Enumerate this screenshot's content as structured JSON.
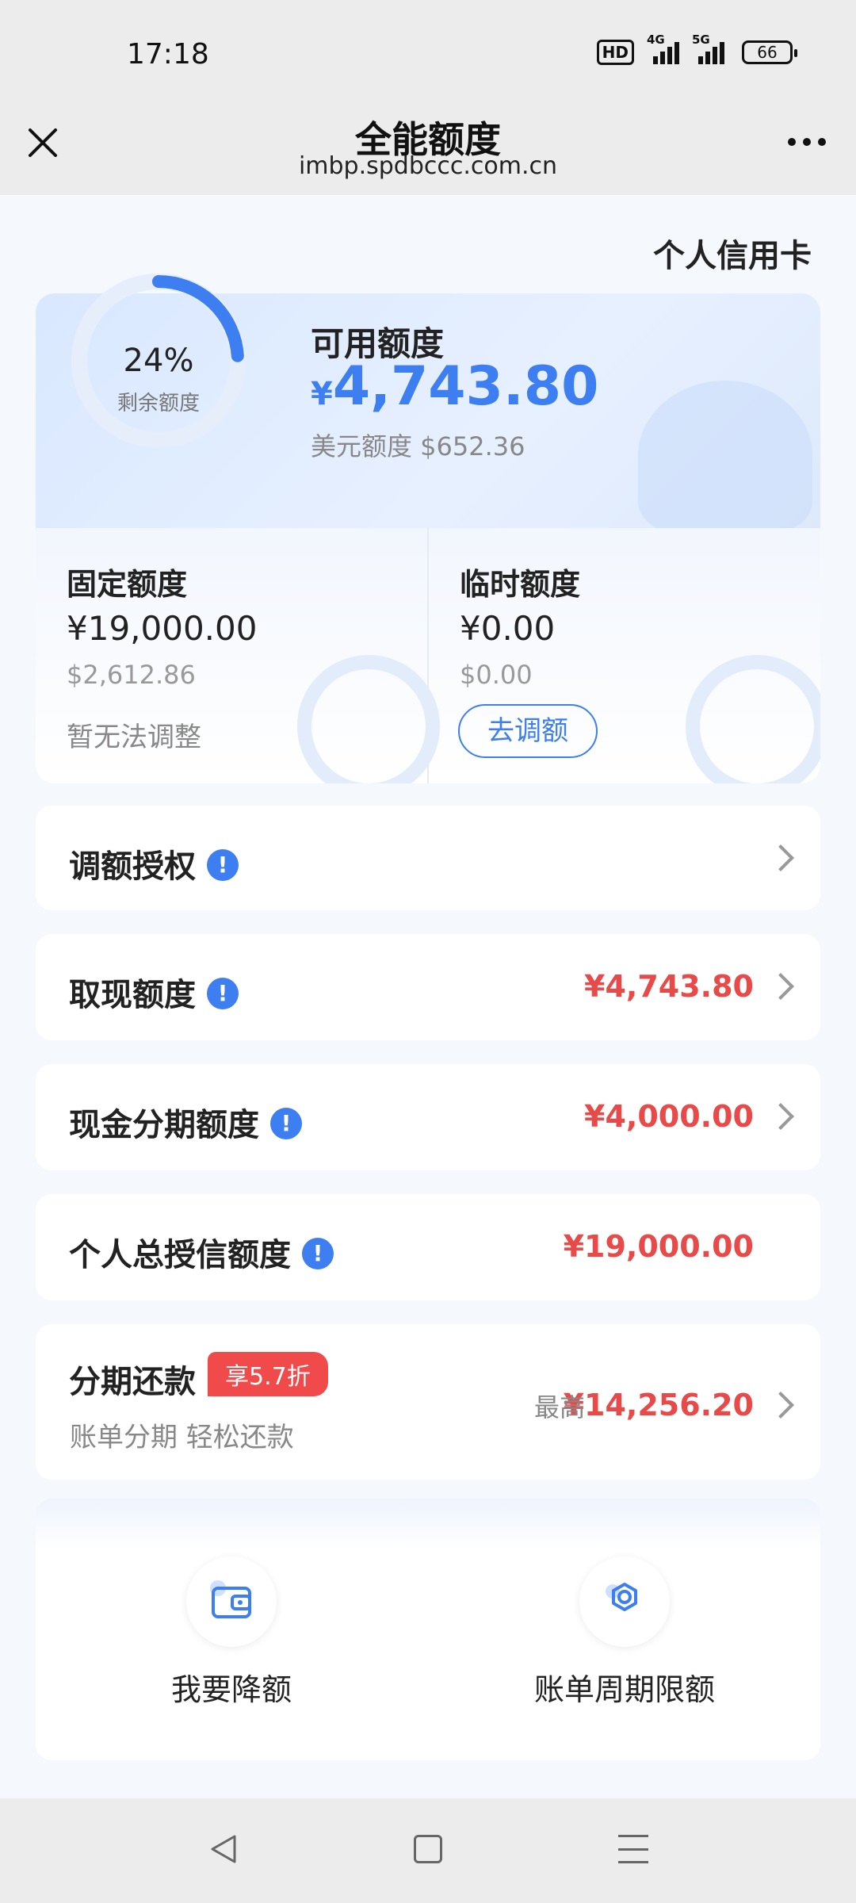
{
  "status_bar": {
    "time": "17:18",
    "hd": "HD",
    "net1": "4G",
    "net2": "5G",
    "battery": "66"
  },
  "header": {
    "title": "全能额度",
    "url": "imbp.spdbccc.com.cn"
  },
  "card_type": "个人信用卡",
  "summary": {
    "ring_percent": "24%",
    "ring_label": "剩余额度",
    "ring_fraction": 0.24,
    "available_label": "可用额度",
    "available_currency": "¥",
    "available_amount": "4,743.80",
    "usd_line": "美元额度 $652.36"
  },
  "fixed": {
    "label": "固定额度",
    "amount": "¥19,000.00",
    "usd": "$2,612.86",
    "note": "暂无法调整"
  },
  "temp": {
    "label": "临时额度",
    "amount": "¥0.00",
    "usd": "$0.00",
    "button": "去调额"
  },
  "rows": {
    "auth": {
      "label": "调额授权"
    },
    "cash": {
      "label": "取现额度",
      "value": "¥4,743.80"
    },
    "cash_installment": {
      "label": "现金分期额度",
      "value": "¥4,000.00"
    },
    "total_credit": {
      "label": "个人总授信额度",
      "value": "¥19,000.00"
    },
    "installment": {
      "label": "分期还款",
      "badge": "享5.7折",
      "subtitle": "账单分期 轻松还款",
      "max_label": "最高",
      "value": "¥14,256.20"
    }
  },
  "info_glyph": "!",
  "actions": [
    {
      "label": "我要降额",
      "icon": "wallet-icon"
    },
    {
      "label": "账单周期限额",
      "icon": "gear-icon"
    }
  ],
  "colors": {
    "accent": "#3d7ef0",
    "amount_red": "#e84a4a",
    "badge_red": "#f04a4a"
  }
}
